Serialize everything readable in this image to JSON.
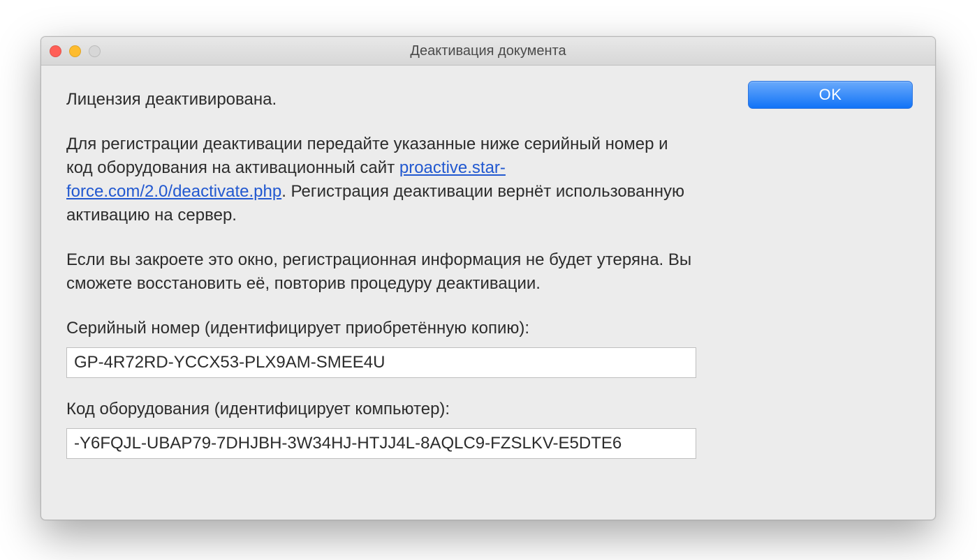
{
  "window": {
    "title": "Деактивация документа"
  },
  "content": {
    "p1": "Лицензия деактивирована.",
    "p2a": "Для регистрации деактивации передайте указанные ниже серийный номер и код оборудования на активационный сайт ",
    "link": "proactive.star-force.com/2.0/deactivate.php",
    "p2b": ". Регистрация деактивации вернёт использованную активацию на сервер.",
    "p3": "Если вы закроете это окно, регистрационная информация не будет утеряна. Вы сможете восстановить её, повторив процедуру деактивации.",
    "serial_label": "Серийный номер (идентифицирует приобретённую копию):",
    "serial_value": "GP-4R72RD-YCCX53-PLX9AM-SMEE4U",
    "hw_label": "Код оборудования (идентифицирует компьютер):",
    "hw_value": "-Y6FQJL-UBAP79-7DHJBH-3W34HJ-HTJJ4L-8AQLC9-FZSLKV-E5DTE6"
  },
  "buttons": {
    "ok": "OK"
  }
}
